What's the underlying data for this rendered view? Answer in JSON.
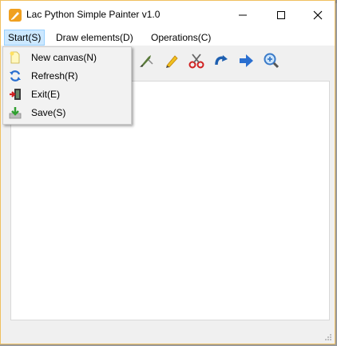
{
  "window": {
    "title": "Lac Python Simple Painter v1.0",
    "accent_border": "#f0c060",
    "controls": {
      "minimize": "minimize-icon",
      "maximize": "maximize-icon",
      "close": "close-icon"
    }
  },
  "menubar": {
    "items": [
      {
        "label": "Start(S)",
        "active": true
      },
      {
        "label": "Draw elements(D)",
        "active": false
      },
      {
        "label": "Operations(C)",
        "active": false
      }
    ]
  },
  "start_menu": {
    "items": [
      {
        "label": "New canvas(N)",
        "icon": "new-canvas-icon"
      },
      {
        "label": "Refresh(R)",
        "icon": "refresh-icon"
      },
      {
        "label": "Exit(E)",
        "icon": "exit-icon"
      },
      {
        "label": "Save(S)",
        "icon": "save-icon"
      }
    ]
  },
  "toolbar": {
    "tools": [
      "brush-icon",
      "pencil-icon",
      "scissors-icon",
      "redo-icon",
      "arrow-right-icon",
      "zoom-in-icon"
    ]
  },
  "colors": {
    "menu_highlight": "#cce8ff",
    "canvas": "#ffffff",
    "window_bg": "#f0f0f0"
  }
}
